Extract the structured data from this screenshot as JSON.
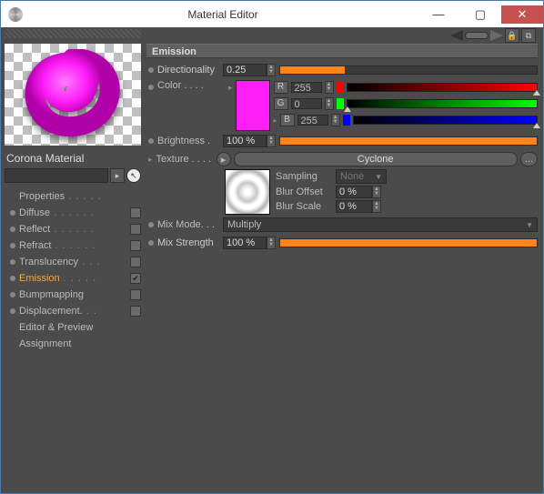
{
  "window": {
    "title": "Material Editor"
  },
  "material_name": "Corona Material",
  "props": [
    {
      "label": "Properties",
      "trail": ". . . . .",
      "check": null,
      "active": false
    },
    {
      "label": "Diffuse",
      "trail": ". . . . . .",
      "check": "",
      "active": false
    },
    {
      "label": "Reflect",
      "trail": ". . . . . .",
      "check": "",
      "active": false
    },
    {
      "label": "Refract",
      "trail": ". . . . . .",
      "check": "",
      "active": false
    },
    {
      "label": "Translucency",
      "trail": ". . .",
      "check": "",
      "active": false
    },
    {
      "label": "Emission",
      "trail": ". . . . .",
      "check": "✔",
      "active": true
    },
    {
      "label": "Bumpmapping",
      "trail": "",
      "check": "",
      "active": false
    },
    {
      "label": "Displacement.",
      "trail": ". .",
      "check": "",
      "active": false
    },
    {
      "label": "Editor & Preview",
      "trail": "",
      "check": null,
      "active": false
    },
    {
      "label": "Assignment",
      "trail": "",
      "check": null,
      "active": false
    }
  ],
  "section": {
    "title": "Emission"
  },
  "directionality": {
    "label": "Directionality",
    "value": "0.25",
    "fill_pct": 25
  },
  "color": {
    "label": "Color",
    "swatch": "#ff1ef8",
    "r": {
      "label": "R",
      "value": "255",
      "grad_from": "#000",
      "grad_to": "#ff0000",
      "tri_pct": 100
    },
    "g": {
      "label": "G",
      "value": "0",
      "grad_from": "#000",
      "grad_to": "#00ff00",
      "tri_pct": 0
    },
    "b": {
      "label": "B",
      "value": "255",
      "grad_from": "#000",
      "grad_to": "#0000ff",
      "tri_pct": 100
    }
  },
  "brightness": {
    "label": "Brightness",
    "value": "100 %",
    "fill_pct": 100
  },
  "texture": {
    "label": "Texture",
    "name": "Cyclone",
    "sampling_label": "Sampling",
    "sampling_value": "None",
    "blur_offset_label": "Blur Offset",
    "blur_offset_value": "0 %",
    "blur_scale_label": "Blur Scale",
    "blur_scale_value": "0 %",
    "browse": "..."
  },
  "mix_mode": {
    "label": "Mix Mode.",
    "value": "Multiply"
  },
  "mix_strength": {
    "label": "Mix Strength",
    "value": "100 %",
    "fill_pct": 100
  }
}
